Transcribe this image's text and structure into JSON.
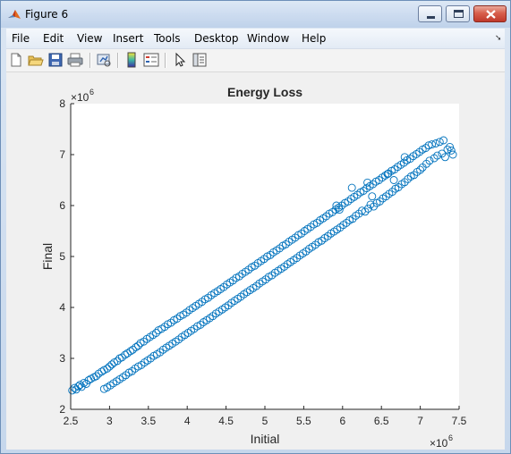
{
  "window": {
    "title": "Figure 6"
  },
  "menu": {
    "items": [
      "File",
      "Edit",
      "View",
      "Insert",
      "Tools",
      "Desktop",
      "Window",
      "Help"
    ]
  },
  "toolbar": {
    "buttons": [
      "new-figure-icon",
      "open-file-icon",
      "save-icon",
      "print-icon",
      "link-plot-icon",
      "colorbar-icon",
      "legend-icon",
      "pointer-icon",
      "property-inspector-icon"
    ]
  },
  "colors": {
    "marker": "#0072BD",
    "axes_text": "#262626",
    "figure_bg": "#f0f0f0"
  },
  "chart_data": {
    "type": "scatter",
    "title": "Energy Loss",
    "xlabel": "Initial",
    "ylabel": "Final",
    "x_exponent_label": "×10",
    "x_exponent": "6",
    "y_exponent_label": "×10",
    "y_exponent": "6",
    "xlim": [
      2.5,
      7.5
    ],
    "ylim": [
      2,
      8
    ],
    "xticks": [
      "2.5",
      "3",
      "3.5",
      "4",
      "4.5",
      "5",
      "5.5",
      "6",
      "6.5",
      "7",
      "7.5"
    ],
    "yticks": [
      "2",
      "3",
      "4",
      "5",
      "6",
      "7",
      "8"
    ],
    "marker": "open-circle",
    "grid": false,
    "points": [
      [
        2.52,
        2.37
      ],
      [
        2.55,
        2.42
      ],
      [
        2.57,
        2.39
      ],
      [
        2.6,
        2.45
      ],
      [
        2.62,
        2.48
      ],
      [
        2.64,
        2.44
      ],
      [
        2.67,
        2.52
      ],
      [
        2.7,
        2.5
      ],
      [
        2.73,
        2.57
      ],
      [
        2.76,
        2.6
      ],
      [
        2.8,
        2.63
      ],
      [
        2.83,
        2.65
      ],
      [
        2.86,
        2.7
      ],
      [
        2.9,
        2.74
      ],
      [
        2.93,
        2.77
      ],
      [
        2.97,
        2.8
      ],
      [
        3.0,
        2.84
      ],
      [
        3.03,
        2.88
      ],
      [
        3.06,
        2.92
      ],
      [
        3.1,
        2.95
      ],
      [
        3.13,
        3.0
      ],
      [
        3.16,
        3.02
      ],
      [
        3.2,
        3.07
      ],
      [
        3.23,
        3.1
      ],
      [
        3.27,
        3.14
      ],
      [
        3.3,
        3.17
      ],
      [
        3.34,
        3.22
      ],
      [
        3.37,
        3.25
      ],
      [
        3.4,
        3.3
      ],
      [
        3.44,
        3.33
      ],
      [
        3.48,
        3.38
      ],
      [
        3.52,
        3.42
      ],
      [
        3.56,
        3.46
      ],
      [
        3.6,
        3.5
      ],
      [
        3.63,
        3.55
      ],
      [
        3.67,
        3.58
      ],
      [
        3.71,
        3.62
      ],
      [
        3.75,
        3.67
      ],
      [
        3.79,
        3.7
      ],
      [
        3.83,
        3.75
      ],
      [
        3.87,
        3.78
      ],
      [
        3.91,
        3.83
      ],
      [
        3.95,
        3.86
      ],
      [
        3.99,
        3.9
      ],
      [
        4.03,
        3.95
      ],
      [
        4.07,
        3.99
      ],
      [
        4.11,
        4.03
      ],
      [
        4.15,
        4.07
      ],
      [
        4.19,
        4.11
      ],
      [
        4.23,
        4.16
      ],
      [
        4.27,
        4.19
      ],
      [
        4.31,
        4.24
      ],
      [
        4.35,
        4.28
      ],
      [
        4.39,
        4.32
      ],
      [
        4.43,
        4.36
      ],
      [
        4.47,
        4.4
      ],
      [
        4.51,
        4.45
      ],
      [
        4.55,
        4.49
      ],
      [
        4.59,
        4.53
      ],
      [
        4.63,
        4.58
      ],
      [
        4.67,
        4.61
      ],
      [
        4.71,
        4.66
      ],
      [
        4.75,
        4.7
      ],
      [
        4.79,
        4.74
      ],
      [
        4.83,
        4.79
      ],
      [
        4.87,
        4.82
      ],
      [
        4.91,
        4.87
      ],
      [
        4.95,
        4.91
      ],
      [
        4.99,
        4.95
      ],
      [
        5.03,
        5.0
      ],
      [
        5.07,
        5.03
      ],
      [
        5.11,
        5.08
      ],
      [
        5.15,
        5.12
      ],
      [
        5.19,
        5.16
      ],
      [
        5.23,
        5.21
      ],
      [
        5.27,
        5.24
      ],
      [
        5.31,
        5.29
      ],
      [
        5.35,
        5.33
      ],
      [
        5.39,
        5.37
      ],
      [
        5.43,
        5.42
      ],
      [
        5.47,
        5.45
      ],
      [
        5.51,
        5.5
      ],
      [
        5.55,
        5.54
      ],
      [
        5.59,
        5.58
      ],
      [
        5.63,
        5.63
      ],
      [
        5.67,
        5.66
      ],
      [
        5.71,
        5.71
      ],
      [
        5.75,
        5.75
      ],
      [
        5.79,
        5.79
      ],
      [
        5.83,
        5.84
      ],
      [
        5.87,
        5.87
      ],
      [
        5.91,
        5.92
      ],
      [
        5.95,
        5.96
      ],
      [
        5.99,
        6.0
      ],
      [
        6.03,
        6.05
      ],
      [
        6.07,
        6.08
      ],
      [
        6.11,
        6.13
      ],
      [
        6.15,
        6.17
      ],
      [
        6.19,
        6.21
      ],
      [
        6.23,
        6.26
      ],
      [
        6.27,
        6.29
      ],
      [
        6.31,
        6.34
      ],
      [
        6.35,
        6.38
      ],
      [
        6.39,
        6.42
      ],
      [
        6.43,
        6.47
      ],
      [
        6.47,
        6.5
      ],
      [
        6.51,
        6.55
      ],
      [
        6.55,
        6.59
      ],
      [
        6.59,
        6.63
      ],
      [
        6.63,
        6.68
      ],
      [
        6.67,
        6.71
      ],
      [
        6.71,
        6.76
      ],
      [
        6.75,
        6.8
      ],
      [
        6.79,
        6.84
      ],
      [
        6.83,
        6.89
      ],
      [
        6.87,
        6.92
      ],
      [
        6.91,
        6.97
      ],
      [
        6.95,
        7.01
      ],
      [
        6.99,
        7.05
      ],
      [
        7.03,
        7.1
      ],
      [
        7.07,
        7.13
      ],
      [
        7.11,
        7.18
      ],
      [
        7.15,
        7.2
      ],
      [
        7.2,
        7.22
      ],
      [
        7.25,
        7.25
      ],
      [
        7.3,
        7.28
      ],
      [
        7.35,
        7.1
      ],
      [
        7.4,
        7.08
      ],
      [
        7.42,
        7.0
      ],
      [
        7.38,
        7.15
      ],
      [
        7.32,
        6.95
      ],
      [
        7.28,
        7.02
      ],
      [
        7.22,
        6.98
      ],
      [
        7.18,
        6.93
      ],
      [
        7.12,
        6.88
      ],
      [
        7.08,
        6.82
      ],
      [
        7.03,
        6.75
      ],
      [
        7.0,
        6.7
      ],
      [
        6.96,
        6.66
      ],
      [
        6.92,
        6.6
      ],
      [
        6.88,
        6.57
      ],
      [
        6.84,
        6.52
      ],
      [
        6.8,
        6.46
      ],
      [
        6.76,
        6.42
      ],
      [
        6.72,
        6.36
      ],
      [
        6.68,
        6.33
      ],
      [
        6.64,
        6.27
      ],
      [
        6.6,
        6.23
      ],
      [
        6.56,
        6.18
      ],
      [
        6.52,
        6.14
      ],
      [
        6.48,
        6.08
      ],
      [
        6.44,
        6.05
      ],
      [
        6.4,
        5.98
      ],
      [
        6.36,
        6.02
      ],
      [
        6.33,
        5.94
      ],
      [
        6.29,
        5.88
      ],
      [
        6.25,
        5.9
      ],
      [
        6.21,
        5.84
      ],
      [
        6.17,
        5.8
      ],
      [
        6.13,
        5.74
      ],
      [
        6.09,
        5.71
      ],
      [
        6.05,
        5.66
      ],
      [
        6.01,
        5.62
      ],
      [
        5.97,
        5.57
      ],
      [
        5.93,
        5.53
      ],
      [
        5.89,
        5.49
      ],
      [
        5.85,
        5.45
      ],
      [
        5.81,
        5.4
      ],
      [
        5.77,
        5.36
      ],
      [
        5.73,
        5.31
      ],
      [
        5.69,
        5.28
      ],
      [
        5.65,
        5.23
      ],
      [
        5.61,
        5.19
      ],
      [
        5.57,
        5.15
      ],
      [
        5.53,
        5.1
      ],
      [
        5.49,
        5.06
      ],
      [
        5.45,
        5.02
      ],
      [
        5.41,
        4.97
      ],
      [
        5.37,
        4.93
      ],
      [
        5.33,
        4.89
      ],
      [
        5.29,
        4.85
      ],
      [
        5.25,
        4.8
      ],
      [
        5.21,
        4.76
      ],
      [
        5.17,
        4.72
      ],
      [
        5.13,
        4.68
      ],
      [
        5.09,
        4.63
      ],
      [
        5.05,
        4.6
      ],
      [
        5.01,
        4.55
      ],
      [
        4.97,
        4.51
      ],
      [
        4.93,
        4.47
      ],
      [
        4.89,
        4.42
      ],
      [
        4.85,
        4.38
      ],
      [
        4.81,
        4.34
      ],
      [
        4.77,
        4.3
      ],
      [
        4.73,
        4.26
      ],
      [
        4.69,
        4.21
      ],
      [
        4.65,
        4.17
      ],
      [
        4.61,
        4.13
      ],
      [
        4.57,
        4.09
      ],
      [
        4.53,
        4.04
      ],
      [
        4.49,
        4.0
      ],
      [
        4.45,
        3.96
      ],
      [
        4.41,
        3.92
      ],
      [
        4.37,
        3.88
      ],
      [
        4.33,
        3.83
      ],
      [
        4.29,
        3.79
      ],
      [
        4.25,
        3.75
      ],
      [
        4.21,
        3.71
      ],
      [
        4.17,
        3.66
      ],
      [
        4.13,
        3.63
      ],
      [
        4.09,
        3.58
      ],
      [
        4.05,
        3.54
      ],
      [
        4.01,
        3.5
      ],
      [
        3.97,
        3.46
      ],
      [
        3.93,
        3.42
      ],
      [
        3.89,
        3.37
      ],
      [
        3.85,
        3.33
      ],
      [
        3.81,
        3.29
      ],
      [
        3.77,
        3.25
      ],
      [
        3.73,
        3.21
      ],
      [
        3.69,
        3.17
      ],
      [
        3.65,
        3.12
      ],
      [
        3.61,
        3.08
      ],
      [
        3.57,
        3.05
      ],
      [
        3.53,
        3.0
      ],
      [
        3.49,
        2.96
      ],
      [
        3.45,
        2.92
      ],
      [
        3.41,
        2.87
      ],
      [
        3.37,
        2.84
      ],
      [
        3.33,
        2.8
      ],
      [
        3.29,
        2.75
      ],
      [
        3.25,
        2.72
      ],
      [
        3.21,
        2.67
      ],
      [
        3.17,
        2.63
      ],
      [
        3.13,
        2.59
      ],
      [
        3.09,
        2.55
      ],
      [
        3.05,
        2.51
      ],
      [
        3.01,
        2.47
      ],
      [
        2.97,
        2.43
      ],
      [
        2.93,
        2.4
      ],
      [
        6.12,
        6.35
      ],
      [
        6.58,
        6.62
      ],
      [
        6.38,
        6.18
      ],
      [
        5.92,
        6.0
      ],
      [
        6.66,
        6.5
      ],
      [
        5.96,
        5.92
      ],
      [
        6.32,
        6.45
      ],
      [
        6.8,
        6.95
      ]
    ]
  }
}
